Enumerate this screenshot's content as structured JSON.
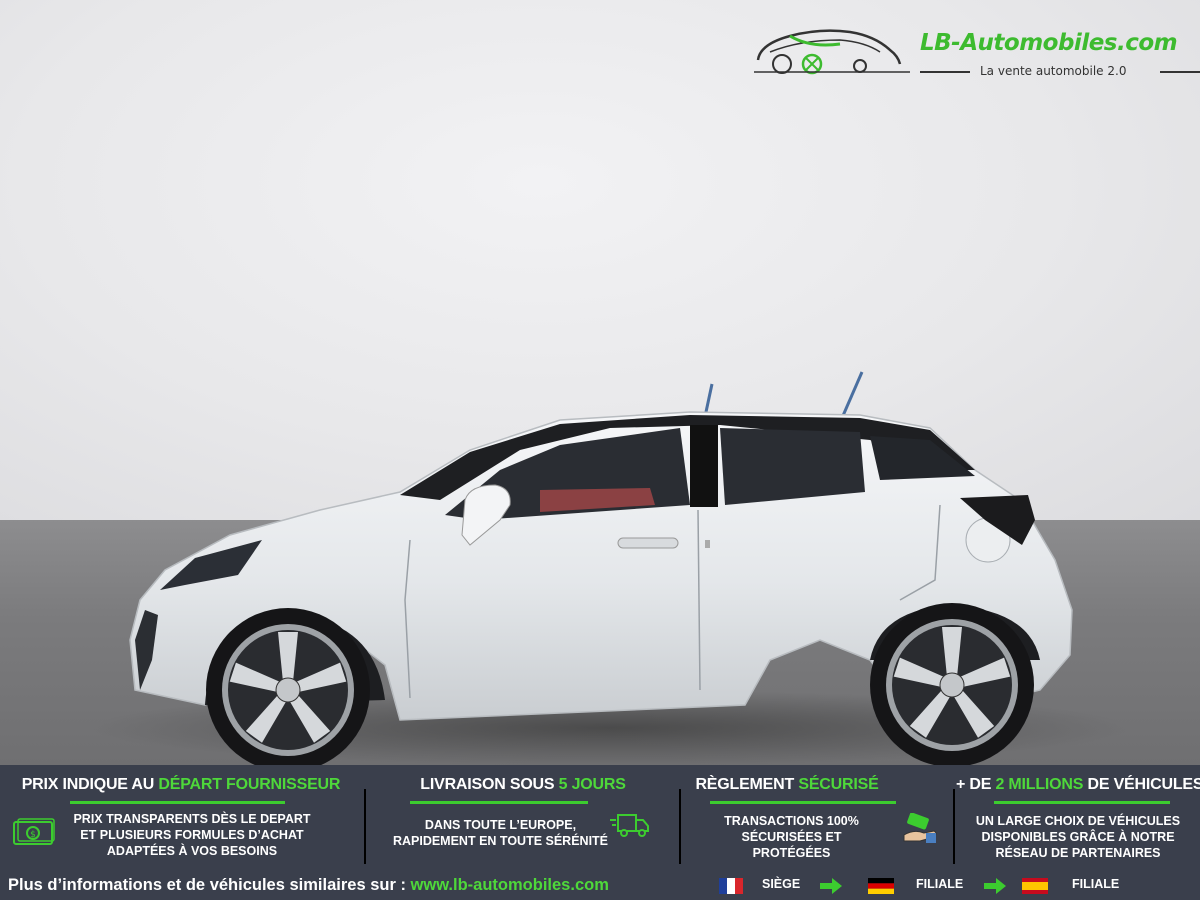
{
  "brand": {
    "name": "LB-Automobiles.com",
    "tagline": "La vente automobile 2.0"
  },
  "colors": {
    "accent_green": "#4ed83a",
    "band_background": "#3a3f4c",
    "car_body": "#e9ecef"
  },
  "banner": {
    "blocks": [
      {
        "title_prefix": "PRIX INDIQUE AU ",
        "title_highlight": "DÉPART FOURNISSEUR",
        "title_suffix": "",
        "text": "PRIX TRANSPARENTS DÈS LE DEPART\nET PLUSIEURS FORMULES D’ACHAT\nADAPTÉES À VOS BESOINS",
        "icon": "money-icon"
      },
      {
        "title_prefix": "LIVRAISON SOUS ",
        "title_highlight": "5 JOURS",
        "title_suffix": "",
        "text": "DANS TOUTE L’EUROPE,\nRAPIDEMENT EN TOUTE SÉRÉNITÉ",
        "icon": "delivery-truck-icon"
      },
      {
        "title_prefix": "RÈGLEMENT ",
        "title_highlight": "SÉCURISÉ",
        "title_suffix": "",
        "text": "TRANSACTIONS 100%\nSÉCURISÉES ET PROTÉGÉES",
        "icon": "payment-hand-icon"
      },
      {
        "title_prefix": "+ DE ",
        "title_highlight": "2 MILLIONS",
        "title_suffix": " DE VÉHICULES",
        "text": "UN LARGE CHOIX DE VÉHICULES\nDISPONIBLES GRÂCE À NOTRE\nRÉSEAU DE PARTENAIRES",
        "icon": ""
      }
    ]
  },
  "footer": {
    "info_text": "Plus d’informations et de véhicules similaires sur : ",
    "link": "www.lb-automobiles.com",
    "locations": [
      {
        "flag": "france-flag-icon",
        "label": "SIÈGE"
      },
      {
        "flag": "germany-flag-icon",
        "label": "FILIALE"
      },
      {
        "flag": "spain-flag-icon",
        "label": "FILIALE"
      }
    ]
  }
}
